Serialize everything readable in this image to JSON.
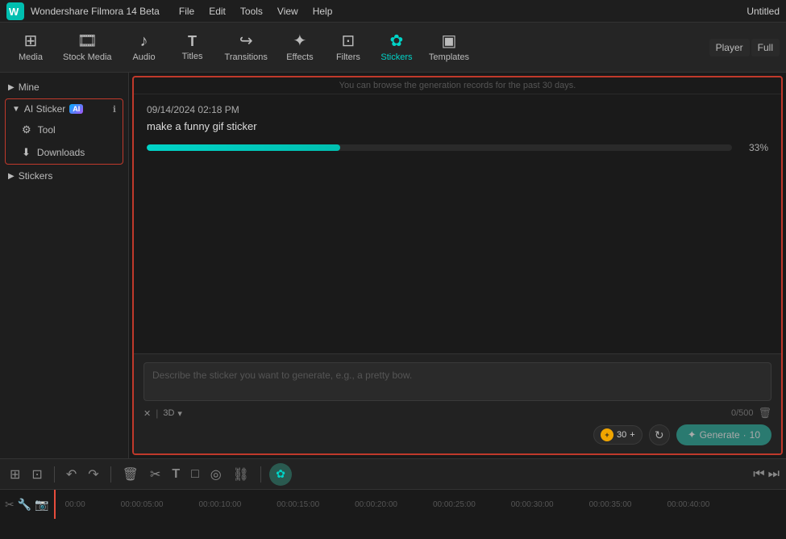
{
  "app": {
    "name": "Wondershare Filmora 14 Beta",
    "window_title": "Untitled"
  },
  "menu": {
    "items": [
      "File",
      "Edit",
      "Tools",
      "View",
      "Help"
    ]
  },
  "toolbar": {
    "items": [
      {
        "id": "media",
        "label": "Media",
        "icon": "⊞",
        "active": false
      },
      {
        "id": "stock_media",
        "label": "Stock Media",
        "icon": "🎞",
        "active": false
      },
      {
        "id": "audio",
        "label": "Audio",
        "icon": "♪",
        "active": false
      },
      {
        "id": "titles",
        "label": "Titles",
        "icon": "T",
        "active": false
      },
      {
        "id": "transitions",
        "label": "Transitions",
        "icon": "↪",
        "active": false
      },
      {
        "id": "effects",
        "label": "Effects",
        "icon": "✦",
        "active": false
      },
      {
        "id": "filters",
        "label": "Filters",
        "icon": "⊡",
        "active": false
      },
      {
        "id": "stickers",
        "label": "Stickers",
        "icon": "✿",
        "active": true
      },
      {
        "id": "templates",
        "label": "Templates",
        "icon": "▣",
        "active": false
      }
    ],
    "player_tabs": [
      "Player",
      "Full"
    ]
  },
  "sidebar": {
    "mine_label": "Mine",
    "ai_sticker_label": "AI Sticker",
    "ai_badge": "AI",
    "tool_label": "Tool",
    "downloads_label": "Downloads",
    "stickers_label": "Stickers"
  },
  "panel": {
    "notice": "You can browse the generation records for the past 30 days.",
    "record": {
      "timestamp": "09/14/2024 02:18 PM",
      "prompt": "make a funny gif sticker",
      "progress": 33,
      "progress_label": "33%"
    },
    "input": {
      "placeholder": "Describe the sticker you want to generate, e.g., a pretty bow.",
      "char_count": "0/500",
      "style_x": "✕",
      "style_3d": "3D",
      "style_arrow": "▾",
      "credits": "30",
      "generate_label": "Generate",
      "generate_icon": "✦",
      "generate_count": "10"
    }
  },
  "timeline": {
    "toolbar_btns": [
      "⊞",
      "⊡",
      "⊓",
      "✂",
      "T",
      "□",
      "◎",
      "⛓"
    ],
    "track_icons": [
      "🎵",
      "📷",
      "🔧",
      "▶"
    ],
    "time_markers": [
      "00:00",
      "00:00:05:00",
      "00:00:10:00",
      "00:00:15:00",
      "00:00:20:00",
      "00:00:25:00",
      "00:00:30:00",
      "00:00:35:00",
      "00:00:40:00"
    ],
    "playback": [
      "◀",
      "▶"
    ]
  }
}
